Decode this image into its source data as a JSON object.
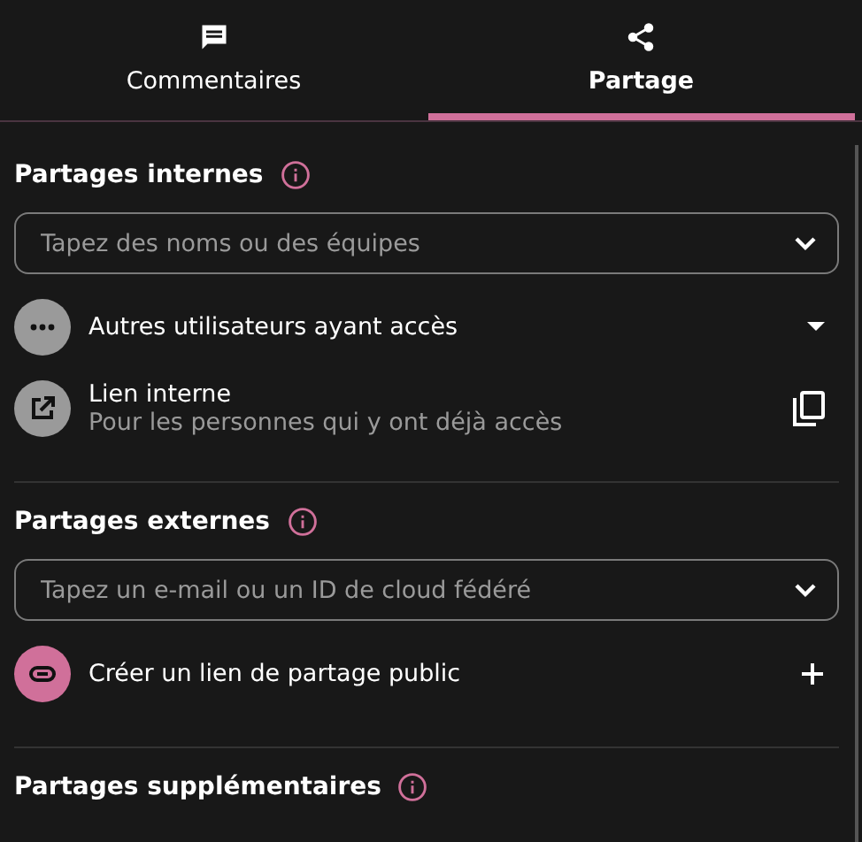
{
  "tabs": [
    {
      "label": "Commentaires",
      "kind": "comments",
      "selected": false
    },
    {
      "label": "Partage",
      "kind": "share",
      "selected": true
    }
  ],
  "sections": [
    {
      "title": "Partages internes",
      "field": {
        "placeholder": "Tapez des noms ou des équipes"
      },
      "items": [
        {
          "kind": "others",
          "label": "Autres utilisateurs ayant accès"
        },
        {
          "kind": "internal-link",
          "label": "Lien interne",
          "sublabel": "Pour les personnes qui y ont déjà accès"
        }
      ]
    },
    {
      "title": "Partages externes",
      "field": {
        "placeholder": "Tapez un e-mail ou un ID de cloud fédéré"
      },
      "items": [
        {
          "kind": "public-link",
          "label": "Créer un lien de partage public"
        }
      ]
    },
    {
      "title": "Partages supplémentaires"
    }
  ]
}
